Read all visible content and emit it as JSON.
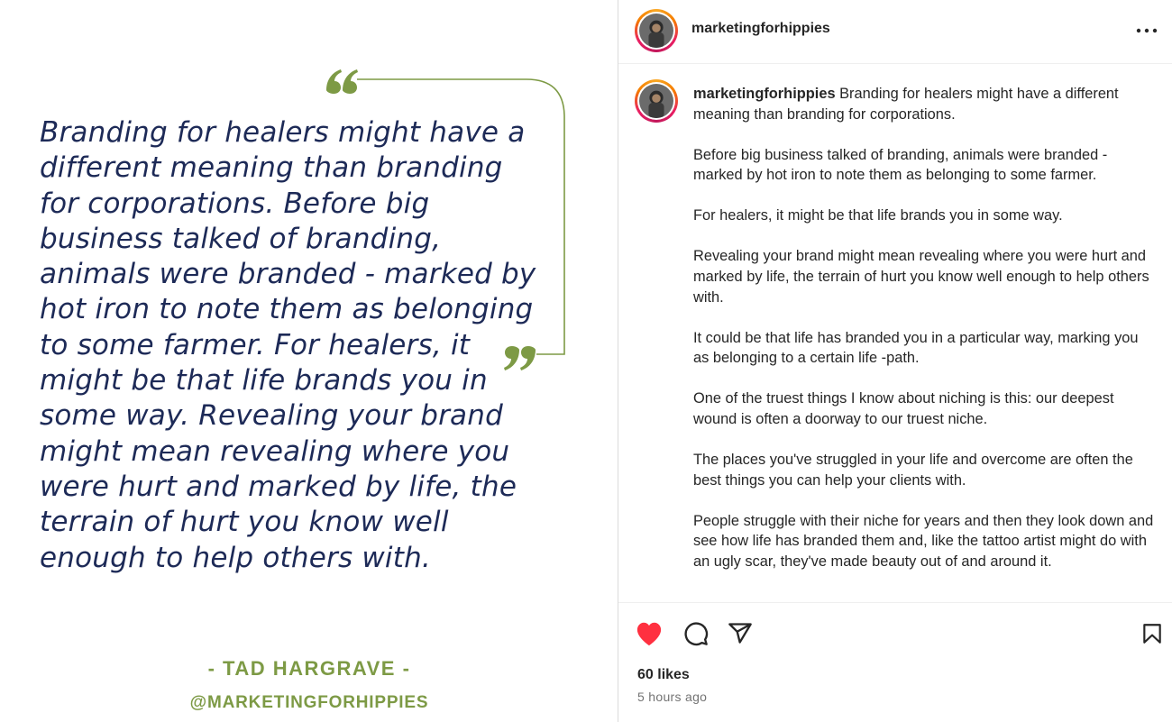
{
  "image": {
    "quote_text": "Branding for healers might have a different meaning than branding for corporations. Before big business talked of branding, animals were branded - marked by hot iron to note them as belonging to some farmer. For healers, it might be that life brands you in some way. Revealing your brand might mean revealing where you were hurt and marked by life, the terrain of hurt you know well enough to help others with.",
    "author": "- TAD HARGRAVE -",
    "handle": "@MARKETINGFORHIPPIES",
    "accent_color": "#7d9a45",
    "text_color": "#1d2a57"
  },
  "post": {
    "header": {
      "username": "marketingforhippies",
      "more_icon": "more-horizontal-icon"
    },
    "caption": {
      "username": "marketingforhippies",
      "first_line": " Branding for healers might have a different meaning than branding for corporations.",
      "paragraphs": [
        "Before big business talked of branding, animals were branded - marked by hot iron to note them as belonging to some farmer.",
        "For healers, it might be that life brands you in some way.",
        "Revealing your brand might mean revealing where you were hurt and marked by life, the terrain of hurt you know well enough to help others with.",
        "It could be that life has branded you in a particular way, marking you as belonging to a certain life -path.",
        "One of the truest things I know about niching is this: our deepest wound is often a doorway to our truest niche.",
        "The places you've struggled in your life and overcome are often the best things you can help your clients with.",
        "People struggle with their niche for years and then they look down and see how life has branded them and, like the tattoo artist might do with an ugly scar, they've made beauty out of and around it."
      ]
    },
    "actions": {
      "like_icon": "heart-filled-icon",
      "comment_icon": "comment-icon",
      "share_icon": "share-icon",
      "save_icon": "bookmark-icon",
      "like_color": "#ff3040"
    },
    "likes": "60 likes",
    "timestamp": "5 hours ago"
  }
}
